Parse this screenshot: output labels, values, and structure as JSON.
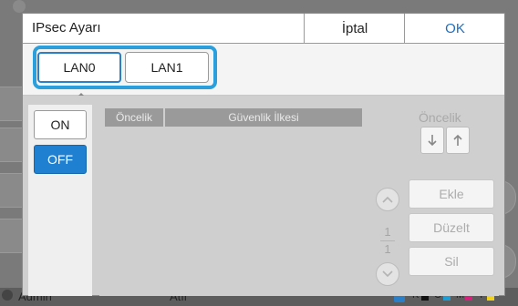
{
  "background": {
    "status_user": "Admin",
    "status_mid": "Atıl",
    "ink_labels": [
      "K",
      "C",
      "M",
      "Y"
    ]
  },
  "dialog": {
    "title": "IPsec Ayarı",
    "cancel_label": "İptal",
    "ok_label": "OK"
  },
  "lan_tabs": {
    "items": [
      {
        "label": "LAN0",
        "selected": true
      },
      {
        "label": "LAN1",
        "selected": false
      }
    ]
  },
  "toggle": {
    "on_label": "ON",
    "off_label": "OFF",
    "selected": "OFF"
  },
  "table": {
    "headers": [
      "Öncelik",
      "Güvenlik İlkesi"
    ],
    "rows": []
  },
  "priority": {
    "label": "Öncelik",
    "down_icon": "arrow-down-icon",
    "up_icon": "arrow-up-icon"
  },
  "pager": {
    "current": "1",
    "total": "1"
  },
  "actions": {
    "add_label": "Ekle",
    "edit_label": "Düzelt",
    "delete_label": "Sil"
  },
  "colors": {
    "accent": "#2a9fdc",
    "ok_text": "#1c6ec4",
    "off_selected": "#1f7fd1"
  }
}
